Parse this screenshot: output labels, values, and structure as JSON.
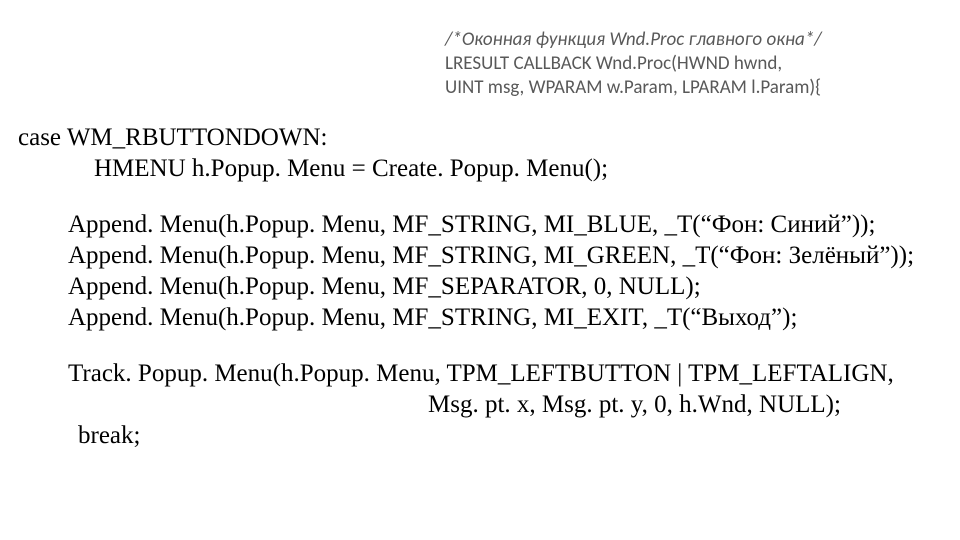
{
  "header": {
    "comment": "/*Оконная функция Wnd.Proc главного окна*/",
    "line2": "LRESULT CALLBACK Wnd.Proc(HWND hwnd,",
    "line3": "UINT msg, WPARAM w.Param, LPARAM l.Param){"
  },
  "code": {
    "l1": "case WM_RBUTTONDOWN:",
    "l2": "HMENU h.Popup. Menu = Create. Popup. Menu();",
    "l3": "Append. Menu(h.Popup. Menu, MF_STRING, MI_BLUE, _T(“Фон: Синий”));",
    "l4": "Append. Menu(h.Popup. Menu, MF_STRING, MI_GREEN, _T(“Фон: Зелёный”));",
    "l5": "Append. Menu(h.Popup. Menu, MF_SEPARATOR, 0, NULL);",
    "l6": "Append. Menu(h.Popup. Menu, MF_STRING, MI_EXIT, _T(“Выход”);",
    "l7": "Track. Popup. Menu(h.Popup. Menu, TPM_LEFTBUTTON | TPM_LEFTALIGN,",
    "l8": "Msg. pt. x, Msg. pt. y, 0, h.Wnd, NULL);",
    "l9": "break;"
  }
}
